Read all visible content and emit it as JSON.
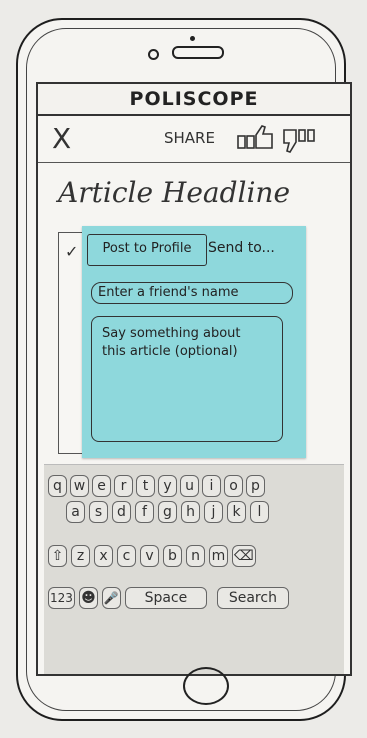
{
  "app": {
    "title": "POLISCOPE"
  },
  "header": {
    "close_label": "X",
    "share_label": "SHARE"
  },
  "article": {
    "headline": "Article Headline"
  },
  "share_panel": {
    "tab_post": "Post to Profile",
    "tab_send": "Send to...",
    "friend_placeholder": "Enter a friend's name",
    "message_placeholder": "Say something about\nthis article (optional)"
  },
  "keyboard": {
    "row1": [
      "q",
      "w",
      "e",
      "r",
      "t",
      "y",
      "u",
      "i",
      "o",
      "p"
    ],
    "row2": [
      "a",
      "s",
      "d",
      "f",
      "g",
      "h",
      "j",
      "k",
      "l"
    ],
    "row3": [
      "⇧",
      "z",
      "x",
      "c",
      "v",
      "b",
      "n",
      "m",
      "⌫"
    ],
    "row4": {
      "numbers": "123",
      "emoji": "☻",
      "mic": "🎤",
      "space": "Space",
      "search": "Search"
    }
  },
  "icons": {
    "like": "thumbs-up-icon",
    "dislike": "thumbs-down-icon",
    "shift": "shift-icon",
    "backspace": "backspace-icon",
    "mic": "microphone-icon",
    "emoji": "emoji-icon"
  },
  "colors": {
    "sticky_note": "#8ed8dc",
    "paper": "#f6f5f2",
    "ink": "#222222"
  }
}
